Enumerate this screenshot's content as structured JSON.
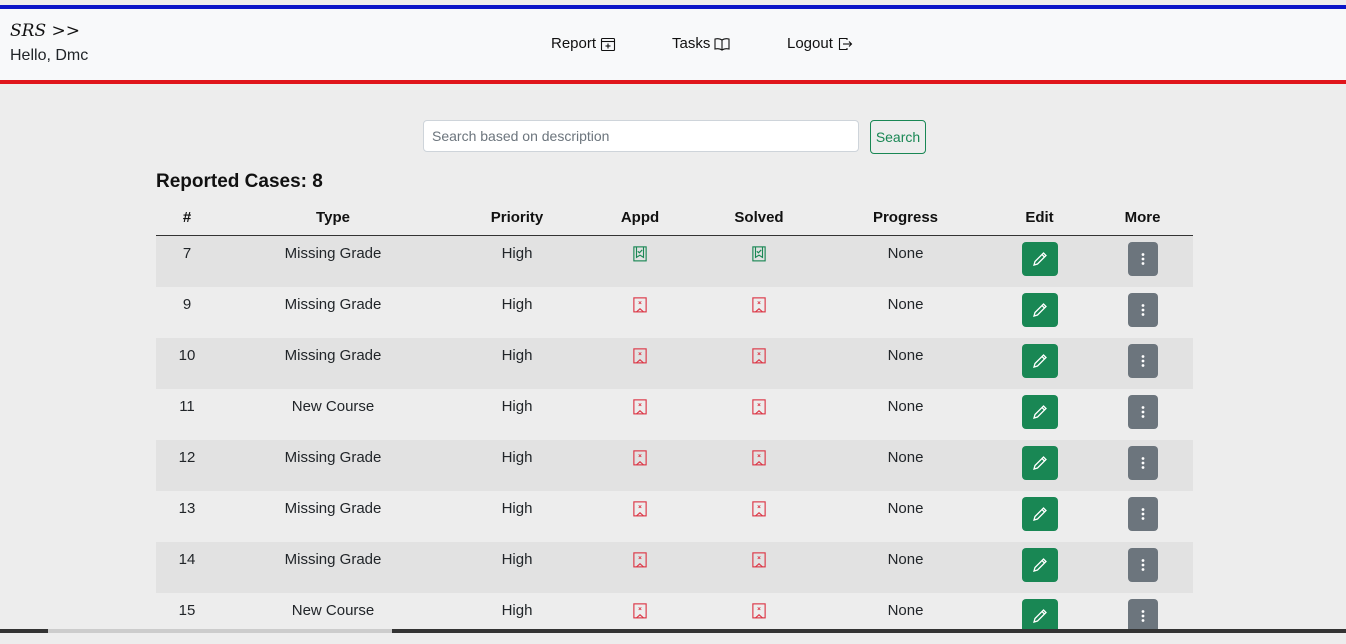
{
  "app": {
    "brand": "SRS >>",
    "greeting": "Hello, Dmc"
  },
  "nav": [
    {
      "label": "Report",
      "icon": "calendar-plus-icon"
    },
    {
      "label": "Tasks",
      "icon": "book-icon"
    },
    {
      "label": "Logout",
      "icon": "box-arrow-right-icon"
    }
  ],
  "search": {
    "placeholder": "Search based on description",
    "value": "",
    "button_label": "Search"
  },
  "cases": {
    "title": "Reported Cases: 8",
    "columns": [
      "#",
      "Type",
      "Priority",
      "Appd",
      "Solved",
      "Progress",
      "Edit",
      "More"
    ],
    "rows": [
      {
        "id": "7",
        "type": "Missing Grade",
        "priority": "High",
        "appd": true,
        "solved": true,
        "progress": "None"
      },
      {
        "id": "9",
        "type": "Missing Grade",
        "priority": "High",
        "appd": false,
        "solved": false,
        "progress": "None"
      },
      {
        "id": "10",
        "type": "Missing Grade",
        "priority": "High",
        "appd": false,
        "solved": false,
        "progress": "None"
      },
      {
        "id": "11",
        "type": "New Course",
        "priority": "High",
        "appd": false,
        "solved": false,
        "progress": "None"
      },
      {
        "id": "12",
        "type": "Missing Grade",
        "priority": "High",
        "appd": false,
        "solved": false,
        "progress": "None"
      },
      {
        "id": "13",
        "type": "Missing Grade",
        "priority": "High",
        "appd": false,
        "solved": false,
        "progress": "None"
      },
      {
        "id": "14",
        "type": "Missing Grade",
        "priority": "High",
        "appd": false,
        "solved": false,
        "progress": "None"
      },
      {
        "id": "15",
        "type": "New Course",
        "priority": "High",
        "appd": false,
        "solved": false,
        "progress": "None"
      }
    ]
  },
  "colors": {
    "accent_blue": "#0a14c8",
    "accent_red": "#e0151b",
    "success": "#198754",
    "danger": "#dc3545",
    "secondary": "#6c757d"
  },
  "icons": {
    "appd_yes": "bookmark-check-icon",
    "appd_no": "bookmark-x-icon",
    "edit": "pencil-icon",
    "more": "three-dots-vertical-icon"
  }
}
